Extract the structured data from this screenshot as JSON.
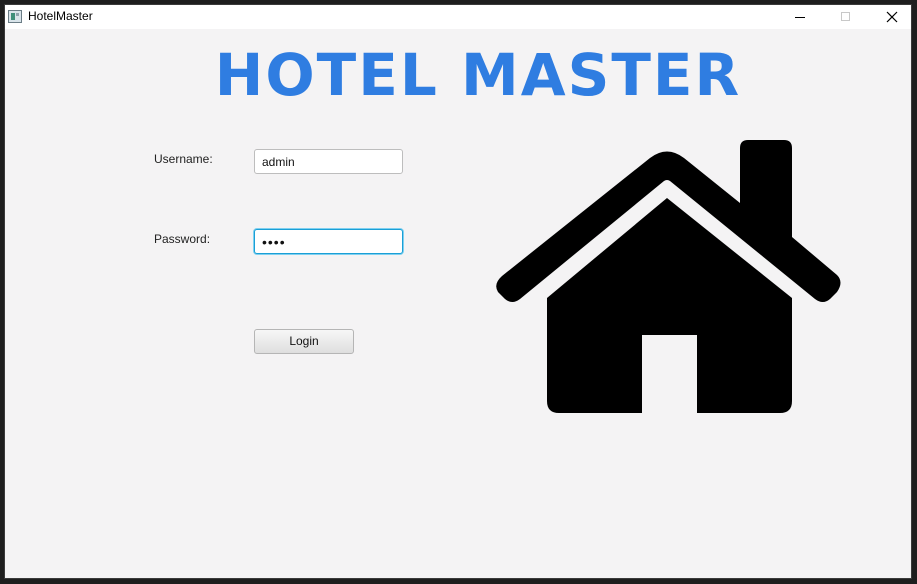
{
  "window": {
    "title": "HotelMaster"
  },
  "header": {
    "heading": "HOTEL MASTER",
    "heading_color": "#2f7de1"
  },
  "login_form": {
    "username_label": "Username:",
    "username_value": "admin",
    "password_label": "Password:",
    "password_value": "••••",
    "login_button_label": "Login"
  },
  "illustration": {
    "icon": "home-icon",
    "color": "#000000"
  }
}
